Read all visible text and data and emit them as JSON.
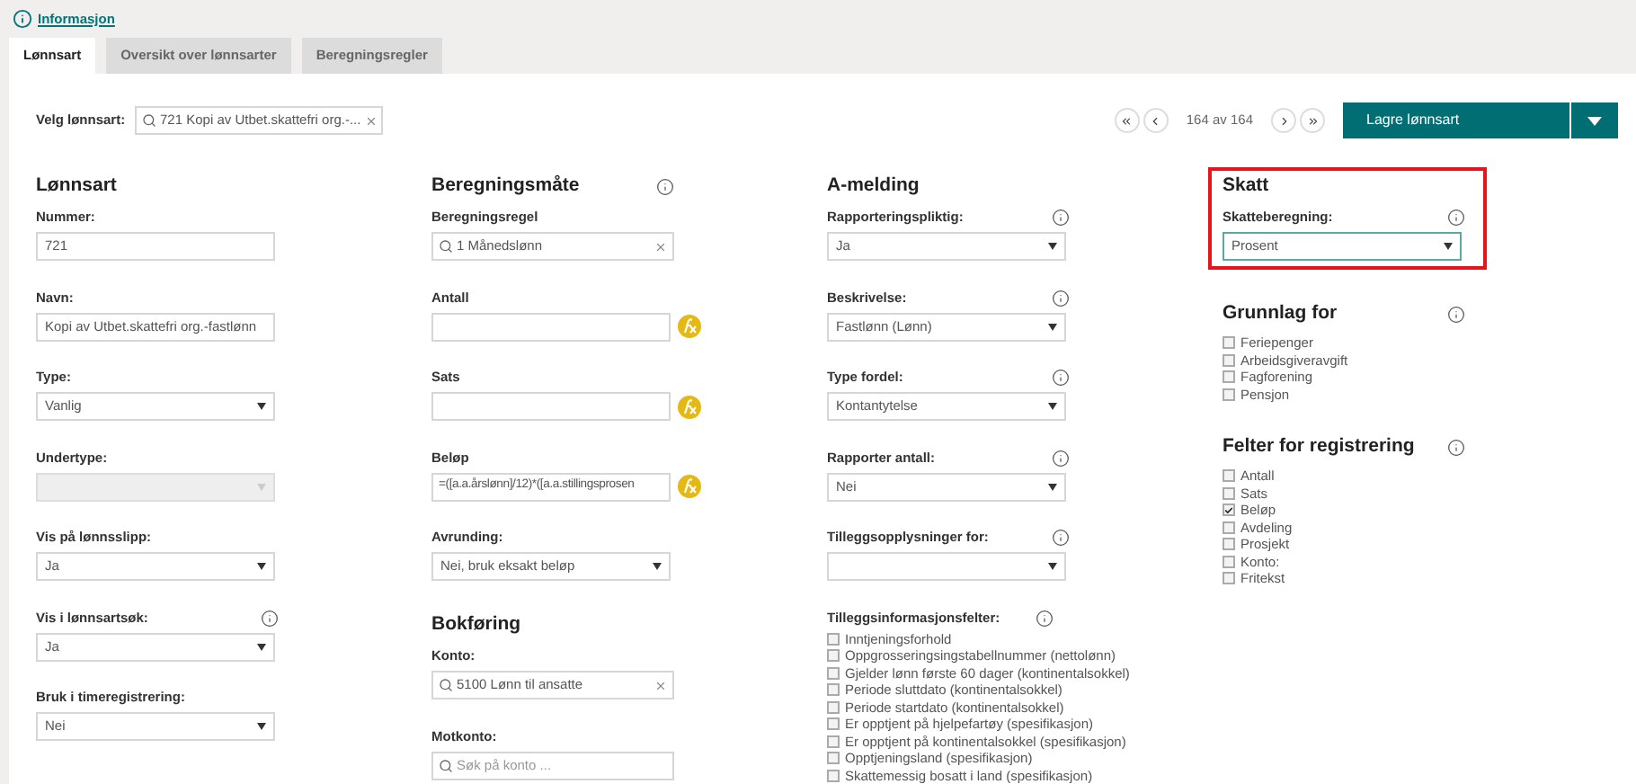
{
  "header_link": {
    "label": "Informasjon"
  },
  "tabs": [
    {
      "label": "Lønnsart",
      "selected": true
    },
    {
      "label": "Oversikt over lønnsarter",
      "selected": false
    },
    {
      "label": "Beregningsregler",
      "selected": false
    }
  ],
  "selector": {
    "label": "Velg lønnsart:",
    "value": "721 Kopi av Utbet.skattefri org.-..."
  },
  "pager": {
    "position": "164 av 164"
  },
  "save_button": {
    "label": "Lagre lønnsart"
  },
  "columns": [
    {
      "sections": [
        {
          "title": "Lønnsart",
          "info": false,
          "highlighted": false,
          "items": [
            {
              "kind": "text",
              "label": "Nummer:",
              "info": false,
              "value": "721"
            },
            {
              "kind": "text",
              "label": "Navn:",
              "info": false,
              "value": "Kopi av Utbet.skattefri org.-fastlønn"
            },
            {
              "kind": "select",
              "label": "Type:",
              "info": false,
              "value": "Vanlig",
              "disabled": false,
              "focused": false
            },
            {
              "kind": "select",
              "label": "Undertype:",
              "info": false,
              "value": "",
              "disabled": true,
              "focused": false
            },
            {
              "kind": "select",
              "label": "Vis på lønnsslipp:",
              "info": false,
              "value": "Ja",
              "disabled": false,
              "focused": false
            },
            {
              "kind": "select",
              "label": "Vis i lønnsartsøk:",
              "info": true,
              "value": "Ja",
              "disabled": false,
              "focused": false
            },
            {
              "kind": "select",
              "label": "Bruk i timeregistrering:",
              "info": false,
              "value": "Nei",
              "disabled": false,
              "focused": false
            }
          ]
        }
      ]
    },
    {
      "sections": [
        {
          "title": "Beregningsmåte",
          "info": true,
          "highlighted": false,
          "items": [
            {
              "kind": "search",
              "label": "Beregningsregel",
              "info": false,
              "value": "1 Månedslønn",
              "clearable": true
            },
            {
              "kind": "formula",
              "label": "Antall",
              "info": false,
              "value": ""
            },
            {
              "kind": "formula",
              "label": "Sats",
              "info": false,
              "value": ""
            },
            {
              "kind": "formula",
              "label": "Beløp",
              "info": false,
              "value": "=([a.a.årslønn]/12)*([a.a.stillingsprosen"
            },
            {
              "kind": "select",
              "label": "Avrunding:",
              "info": false,
              "value": "Nei, bruk eksakt beløp",
              "disabled": false,
              "focused": false
            }
          ]
        },
        {
          "title": "Bokføring",
          "info": false,
          "highlighted": false,
          "items": [
            {
              "kind": "search",
              "label": "Konto:",
              "info": false,
              "value": "5100 Lønn til ansatte",
              "clearable": true
            },
            {
              "kind": "search",
              "label": "Motkonto:",
              "info": false,
              "placeholder": "Søk på konto ...",
              "clearable": false
            }
          ]
        }
      ]
    },
    {
      "sections": [
        {
          "title": "A-melding",
          "info": false,
          "highlighted": false,
          "items": [
            {
              "kind": "select",
              "label": "Rapporteringspliktig:",
              "info": true,
              "value": "Ja",
              "disabled": false,
              "focused": false
            },
            {
              "kind": "select",
              "label": "Beskrivelse:",
              "info": true,
              "value": "Fastlønn (Lønn)",
              "disabled": false,
              "focused": false
            },
            {
              "kind": "select",
              "label": "Type fordel:",
              "info": true,
              "value": "Kontantytelse",
              "disabled": false,
              "focused": false
            },
            {
              "kind": "select",
              "label": "Rapporter antall:",
              "info": true,
              "value": "Nei",
              "disabled": false,
              "focused": false
            },
            {
              "kind": "select",
              "label": "Tilleggsopplysninger for:",
              "info": true,
              "value": "",
              "disabled": false,
              "focused": false
            },
            {
              "kind": "checklist",
              "label": "Tilleggsinformasjonsfelter:",
              "info": true,
              "options": [
                {
                  "label": "Inntjeningsforhold",
                  "checked": false
                },
                {
                  "label": "Oppgrosseringsingstabellnummer (nettolønn)",
                  "checked": false
                },
                {
                  "label": "Gjelder lønn første 60 dager (kontinentalsokkel)",
                  "checked": false
                },
                {
                  "label": "Periode sluttdato (kontinentalsokkel)",
                  "checked": false
                },
                {
                  "label": "Periode startdato (kontinentalsokkel)",
                  "checked": false
                },
                {
                  "label": "Er opptjent på hjelpefartøy (spesifikasjon)",
                  "checked": false
                },
                {
                  "label": "Er opptjent på kontinentalsokkel (spesifikasjon)",
                  "checked": false
                },
                {
                  "label": "Opptjeningsland (spesifikasjon)",
                  "checked": false
                },
                {
                  "label": "Skattemessig bosatt i land (spesifikasjon)",
                  "checked": false
                }
              ]
            }
          ]
        }
      ]
    },
    {
      "sections": [
        {
          "title": "Skatt",
          "info": false,
          "highlighted": true,
          "items": [
            {
              "kind": "select",
              "label": "Skatteberegning:",
              "info": true,
              "value": "Prosent",
              "disabled": false,
              "focused": true
            }
          ]
        },
        {
          "title": "Grunnlag for",
          "info": true,
          "highlighted": false,
          "items": [
            {
              "kind": "checklist",
              "options": [
                {
                  "label": "Feriepenger",
                  "checked": false
                },
                {
                  "label": "Arbeidsgiveravgift",
                  "checked": false
                },
                {
                  "label": "Fagforening",
                  "checked": false
                },
                {
                  "label": "Pensjon",
                  "checked": false
                }
              ]
            }
          ]
        },
        {
          "title": "Felter for registrering",
          "info": true,
          "highlighted": false,
          "items": [
            {
              "kind": "checklist",
              "options": [
                {
                  "label": "Antall",
                  "checked": false
                },
                {
                  "label": "Sats",
                  "checked": false
                },
                {
                  "label": "Beløp",
                  "checked": true
                },
                {
                  "label": "Avdeling",
                  "checked": false
                },
                {
                  "label": "Prosjekt",
                  "checked": false
                },
                {
                  "label": "Konto:",
                  "checked": false
                },
                {
                  "label": "Fritekst",
                  "checked": false
                }
              ]
            }
          ]
        }
      ]
    }
  ]
}
